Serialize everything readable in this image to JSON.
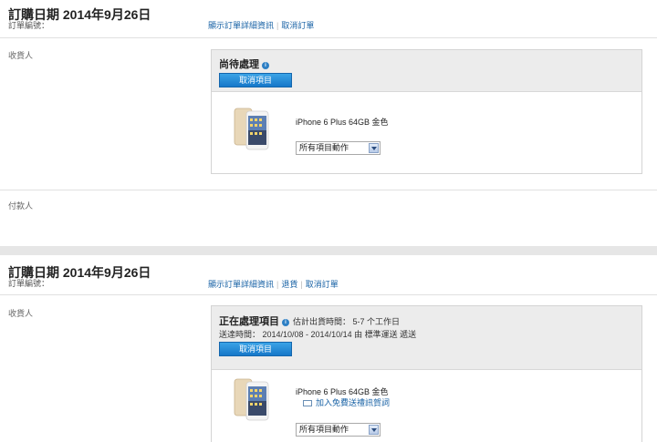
{
  "orders": [
    {
      "date_label": "訂購日期 2014年9月26日",
      "order_no_label": "訂單編號：",
      "links": [
        "顯示訂單詳細資訊",
        "取消訂單"
      ],
      "recipient_label": "收貨人",
      "payer_label": "付款人",
      "status": "尚待處理",
      "cancel_button": "取消項目",
      "product_name": "iPhone 6 Plus 64GB 金色",
      "action_select": "所有項目動作"
    },
    {
      "date_label": "訂購日期 2014年9月26日",
      "order_no_label": "訂單編號：",
      "links": [
        "顯示訂單詳細資訊",
        "退貨",
        "取消訂單"
      ],
      "recipient_label": "收貨人",
      "status": "正在處理項目",
      "eta": "估計出貨時間： 5-7 个工作日",
      "ship_time": "送達時間： 2014/10/08 - 2014/10/14 由 標準運送 遞送",
      "cancel_button": "取消項目",
      "product_name": "iPhone 6 Plus 64GB 金色",
      "gift_link": "加入免費送禮訊賀詞",
      "action_select": "所有項目動作"
    }
  ],
  "colors": {
    "link": "#1a63a6",
    "button": "#1677c9",
    "info_icon": "#2d7fc4"
  },
  "icons": [
    "info-icon",
    "envelope-icon",
    "dropdown-arrow-icon",
    "iphone-product-image"
  ]
}
